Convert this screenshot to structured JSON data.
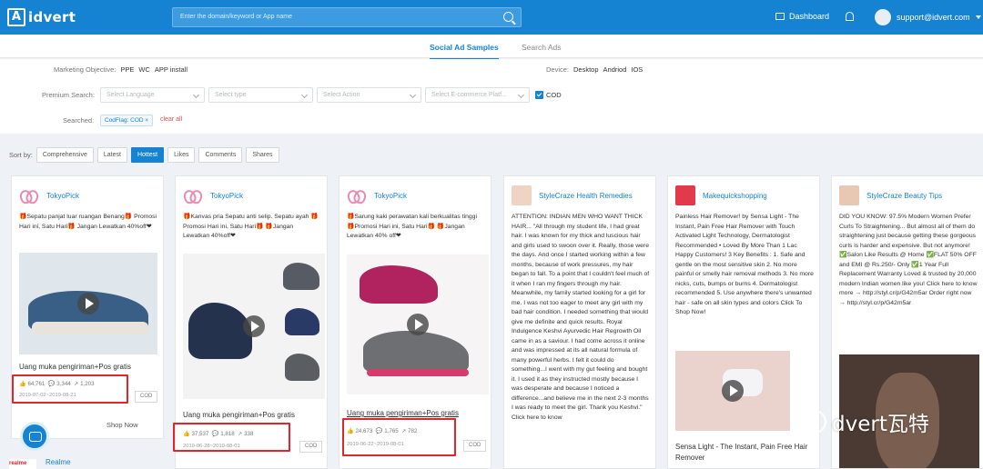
{
  "header": {
    "logo": "idvert",
    "search_placeholder": "Enter the domain/keyword or App name",
    "dashboard": "Dashboard",
    "user": "support@idvert.com"
  },
  "tabs": [
    {
      "label": "Social Ad Samples"
    },
    {
      "label": "Search Ads"
    }
  ],
  "filters": {
    "marketing_label": "Marketing Objective:",
    "marketing_options": [
      "PPE",
      "WC",
      "APP install"
    ],
    "device_label": "Device:",
    "device_options": [
      "Desktop",
      "Andriod",
      "IOS"
    ],
    "premium_label": "Premium Search:",
    "selects": [
      "Select Language",
      "Select type",
      "Select Action",
      "Select E-commerce Platf..."
    ],
    "cod_label": "COD",
    "searched_label": "Searched:",
    "searched_tag": "CodFlag: COD ×",
    "clear_all": "clear all"
  },
  "sort": {
    "label": "Sort by:",
    "options": [
      "Comprehensive",
      "Latest",
      "Hottest",
      "Likes",
      "Comments",
      "Shares"
    ],
    "active": "Hottest"
  },
  "cards": [
    {
      "name": "TokyoPick",
      "text": "🎁Sepatu panjat luar ruangan Benang🎁 Promosi Hari ini, Satu Hari🎁 Jangan Lewatkan 40%off❤",
      "caption": "Uang muka pengiriman+Pos gratis",
      "likes": "64,761",
      "comments": "3,344",
      "shares": "1,203",
      "date": "2019-07-02~2019-08-21",
      "cod": "COD",
      "shop": "Shop Now"
    },
    {
      "name": "TokyoPick",
      "text": "🎁Kanvas pria Sepatu anti selip. Sepatu ayah 🎁Promosi Hari ini, Satu Hari🎁 🎁Jangan Lewatkan 40%off❤",
      "caption": "Uang muka pengiriman+Pos gratis",
      "likes": "37,537",
      "comments": "1,818",
      "shares": "338",
      "date": "2019-06-28~2019-08-01",
      "cod": "COD"
    },
    {
      "name": "TokyoPick",
      "text": "🎁Sarung kaki perawatan kali berkualitas tinggi 🎁Promosi Hari ini, Satu Hari🎁 🎁Jangan Lewatkan 40% off❤",
      "caption": "Uang muka pengiriman+Pos gratis",
      "likes": "24,673",
      "comments": "1,765",
      "shares": "782",
      "date": "2019-06-22~2019-08-01",
      "cod": "COD"
    },
    {
      "name": "StyleCraze Health Remedies",
      "text": "ATTENTION: INDIAN MEN WHO WANT THICK HAIR... \"All through my student life, I had great hair. I was known for my thick and luscious hair and girls used to swoon over it. Really, those were the days. And once I started working within a few months, because of work pressures, my hair began to fall. To a point that I couldn't feel much of it when I ran my fingers through my hair. Meanwhile, my family started looking for a girl for me. I was not too eager to meet any girl with my bad hair condition. I needed something that would give me definite and quick results. Royal Indulgence Keshvi Ayurvedic Hair Regrowth Oil came in as a saviour. I had come across it online and was impressed at its all natural formula of many powerful herbs. I felt it could do something...I went with my gut feeling and bought it. I used it as they instructed mostly because I was desperate and because I noticed a difference...and believe me in the next 2-3 months I was ready to meet the girl. Thank you Keshvi.\" Click here to know"
    },
    {
      "name": "Makequickshopping",
      "text": "Painless Hair Remover! by Sensa Light - The Instant, Pain Free Hair Remover with Touch Activated Light Technology, Dermatologist Recommended • Loved By More Than 1 Lac Happy Customers! 3 Key Benefits : 1. Safe and gentle on the most sensitive skin 2. No more painful or smelly hair removal methods 3. No more nicks, cuts, bumps or burns 4. Dermatologist recommended 5. Use anywhere there's unwanted hair - safe on all skin types and colors Click To Shop Now!",
      "caption": "Sensa Light - The Instant, Pain Free Hair Remover"
    },
    {
      "name": "StyleCraze Beauty Tips",
      "text": "DID YOU KNOW: 97.5% Modern Women Prefer Curls To Straightening... But almost all of them do straightening just because getting these gorgeous curls is harder and expensive. But not anymore! ✅Salon Like Results @ Home ✅FLAT 50% OFF and EMI @ Rs.250/- Only ✅1 Year Full Replacement Warranty Loved & trusted by 20,000 modern Indian women like you! Click here to know more → http://styl.cr/p/G42m5ar Order right now → http://styl.cr/p/G42m5ar"
    }
  ],
  "bottom": {
    "realme": "Realme",
    "realme_logo": "realme"
  },
  "watermark": "dvert瓦特"
}
